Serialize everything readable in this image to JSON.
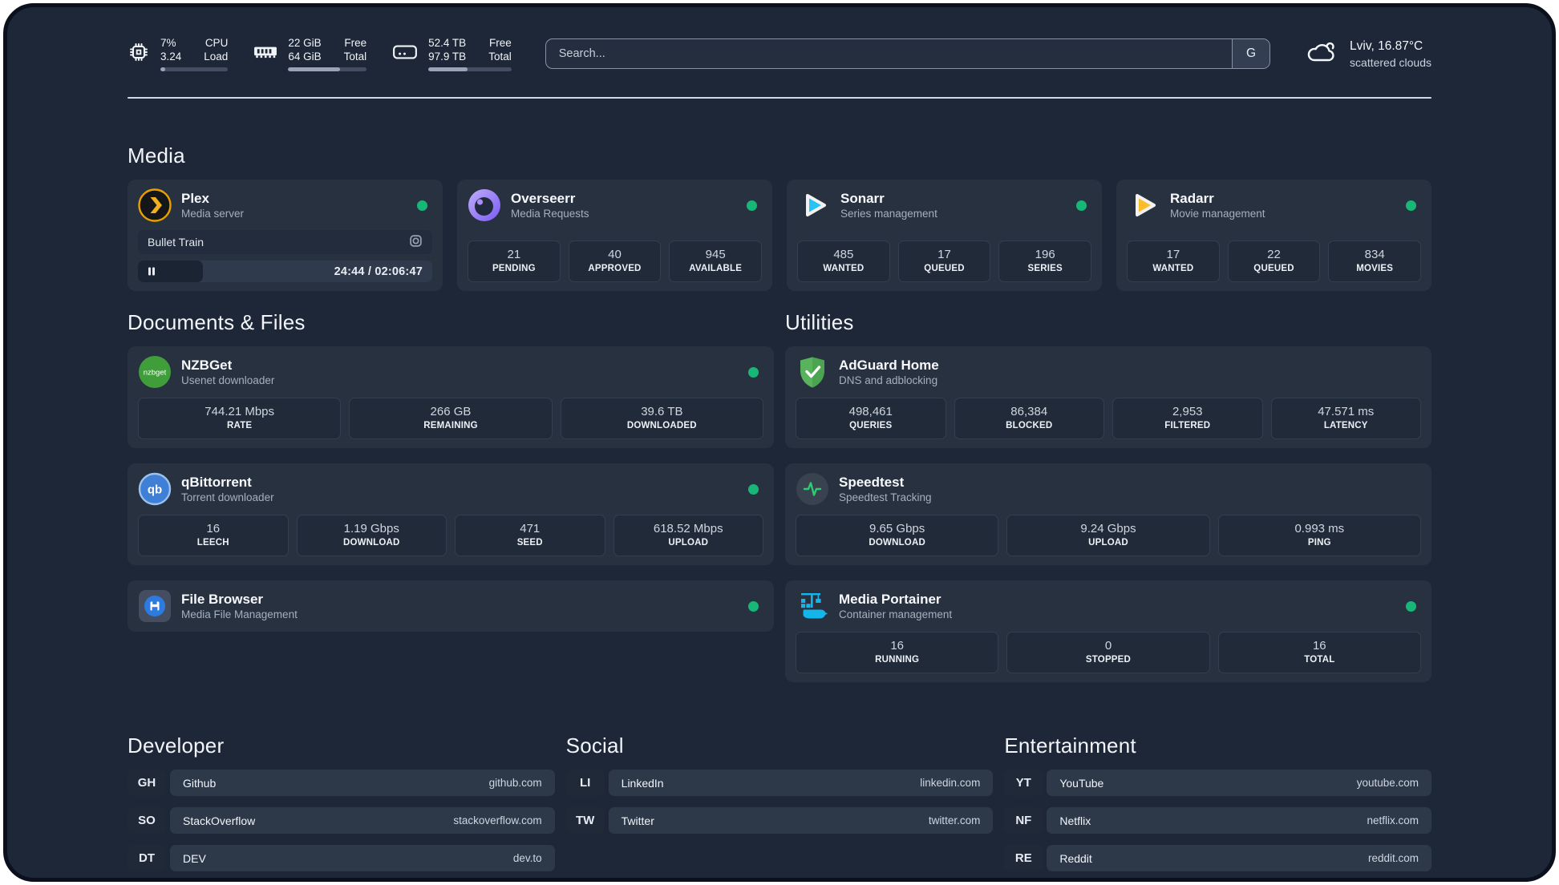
{
  "colors": {
    "status_online": "#17b877"
  },
  "header": {
    "stats": [
      {
        "icon": "cpu-icon",
        "top_value": "7%",
        "bottom_value": "3.24",
        "top_label": "CPU",
        "bottom_label": "Load",
        "progress": 7
      },
      {
        "icon": "ram-icon",
        "top_value": "22 GiB",
        "bottom_value": "64 GiB",
        "top_label": "Free",
        "bottom_label": "Total",
        "progress": 66
      },
      {
        "icon": "disk-icon",
        "top_value": "52.4 TB",
        "bottom_value": "97.9 TB",
        "top_label": "Free",
        "bottom_label": "Total",
        "progress": 47
      }
    ],
    "search": {
      "placeholder": "Search...",
      "button": "G"
    },
    "weather": {
      "location": "Lviv, 16.87°C",
      "condition": "scattered clouds"
    }
  },
  "media": {
    "title": "Media",
    "plex": {
      "name": "Plex",
      "subtitle": "Media server",
      "online": true,
      "player": {
        "track": "Bullet Train",
        "time": "24:44 / 02:06:47",
        "progress": 22
      }
    },
    "overseerr": {
      "name": "Overseerr",
      "subtitle": "Media Requests",
      "online": true,
      "stats": [
        {
          "value": "21",
          "label": "PENDING"
        },
        {
          "value": "40",
          "label": "APPROVED"
        },
        {
          "value": "945",
          "label": "AVAILABLE"
        }
      ]
    },
    "sonarr": {
      "name": "Sonarr",
      "subtitle": "Series management",
      "online": true,
      "stats": [
        {
          "value": "485",
          "label": "WANTED"
        },
        {
          "value": "17",
          "label": "QUEUED"
        },
        {
          "value": "196",
          "label": "SERIES"
        }
      ]
    },
    "radarr": {
      "name": "Radarr",
      "subtitle": "Movie management",
      "online": true,
      "stats": [
        {
          "value": "17",
          "label": "WANTED"
        },
        {
          "value": "22",
          "label": "QUEUED"
        },
        {
          "value": "834",
          "label": "MOVIES"
        }
      ]
    }
  },
  "documents": {
    "title": "Documents & Files",
    "nzbget": {
      "name": "NZBGet",
      "subtitle": "Usenet downloader",
      "online": true,
      "icon_text": "nzbget",
      "stats": [
        {
          "value": "744.21 Mbps",
          "label": "RATE"
        },
        {
          "value": "266 GB",
          "label": "REMAINING"
        },
        {
          "value": "39.6 TB",
          "label": "DOWNLOADED"
        }
      ]
    },
    "qbittorrent": {
      "name": "qBittorrent",
      "subtitle": "Torrent downloader",
      "online": true,
      "icon_text": "qb",
      "stats": [
        {
          "value": "16",
          "label": "LEECH"
        },
        {
          "value": "1.19 Gbps",
          "label": "DOWNLOAD"
        },
        {
          "value": "471",
          "label": "SEED"
        },
        {
          "value": "618.52 Mbps",
          "label": "UPLOAD"
        }
      ]
    },
    "filebrowser": {
      "name": "File Browser",
      "subtitle": "Media File Management",
      "online": true
    }
  },
  "utilities": {
    "title": "Utilities",
    "adguard": {
      "name": "AdGuard Home",
      "subtitle": "DNS and adblocking",
      "online": false,
      "stats": [
        {
          "value": "498,461",
          "label": "QUERIES"
        },
        {
          "value": "86,384",
          "label": "BLOCKED"
        },
        {
          "value": "2,953",
          "label": "FILTERED"
        },
        {
          "value": "47.571 ms",
          "label": "LATENCY"
        }
      ]
    },
    "speedtest": {
      "name": "Speedtest",
      "subtitle": "Speedtest Tracking",
      "online": false,
      "stats": [
        {
          "value": "9.65 Gbps",
          "label": "DOWNLOAD"
        },
        {
          "value": "9.24 Gbps",
          "label": "UPLOAD"
        },
        {
          "value": "0.993 ms",
          "label": "PING"
        }
      ]
    },
    "portainer": {
      "name": "Media Portainer",
      "subtitle": "Container management",
      "online": true,
      "stats": [
        {
          "value": "16",
          "label": "RUNNING"
        },
        {
          "value": "0",
          "label": "STOPPED"
        },
        {
          "value": "16",
          "label": "TOTAL"
        }
      ]
    }
  },
  "links": {
    "developer": {
      "title": "Developer",
      "items": [
        {
          "abbr": "GH",
          "name": "Github",
          "url": "github.com"
        },
        {
          "abbr": "SO",
          "name": "StackOverflow",
          "url": "stackoverflow.com"
        },
        {
          "abbr": "DT",
          "name": "DEV",
          "url": "dev.to"
        }
      ]
    },
    "social": {
      "title": "Social",
      "items": [
        {
          "abbr": "LI",
          "name": "LinkedIn",
          "url": "linkedin.com"
        },
        {
          "abbr": "TW",
          "name": "Twitter",
          "url": "twitter.com"
        }
      ]
    },
    "entertainment": {
      "title": "Entertainment",
      "items": [
        {
          "abbr": "YT",
          "name": "YouTube",
          "url": "youtube.com"
        },
        {
          "abbr": "NF",
          "name": "Netflix",
          "url": "netflix.com"
        },
        {
          "abbr": "RE",
          "name": "Reddit",
          "url": "reddit.com"
        }
      ]
    }
  }
}
